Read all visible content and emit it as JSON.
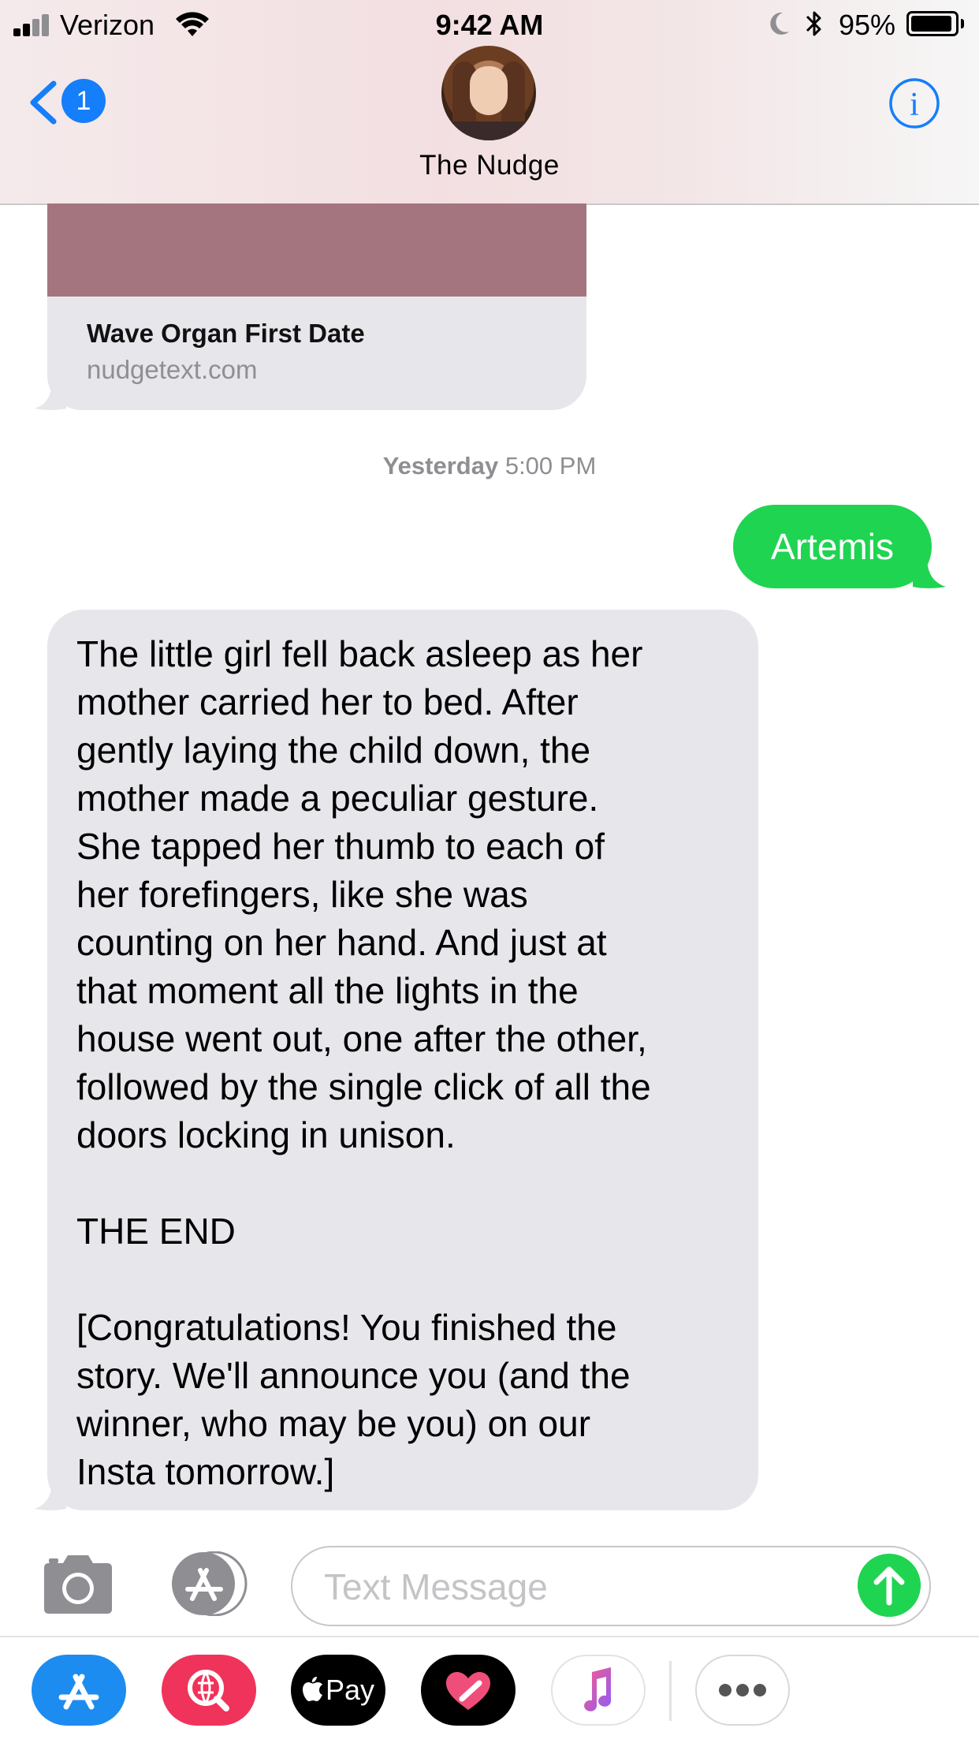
{
  "status_bar": {
    "carrier": "Verizon",
    "time": "9:42 AM",
    "battery_percent": "95%",
    "battery_level": 0.95
  },
  "nav": {
    "back_count": "1",
    "contact_name": "The Nudge",
    "info_label": "i"
  },
  "messages": {
    "link_preview": {
      "title": "Wave Organ First Date",
      "url": "nudgetext.com"
    },
    "timestamp": {
      "day": "Yesterday",
      "time": "5:00 PM"
    },
    "sent": {
      "text": "Artemis"
    },
    "received": {
      "text": "The little girl fell back asleep as her\nmother carried her to bed. After\ngently laying the child down, the\nmother made a peculiar gesture.\nShe tapped her thumb to each of\nher forefingers, like she was\ncounting on her hand. And just at\nthat moment all the lights in the\nhouse went out, one after the other,\nfollowed by the single click of all the\ndoors locking in unison.\n\nTHE END\n\n[Congratulations! You finished the\nstory. We'll announce you (and the\nwinner, who may be you) on our\nInsta tomorrow.]"
    }
  },
  "composer": {
    "placeholder": "Text Message"
  },
  "app_drawer": {
    "apple_pay_label": "Pay",
    "apps": [
      "app-store-icon",
      "web-search-icon",
      "apple-pay-icon",
      "digital-touch-icon",
      "music-icon",
      "more-icon"
    ]
  },
  "colors": {
    "ios_blue": "#157efb",
    "sent_green": "#1fd451",
    "received_gray": "#e6e6eb",
    "timestamp_gray": "#8e8e93",
    "link_image": "#a4757e"
  }
}
